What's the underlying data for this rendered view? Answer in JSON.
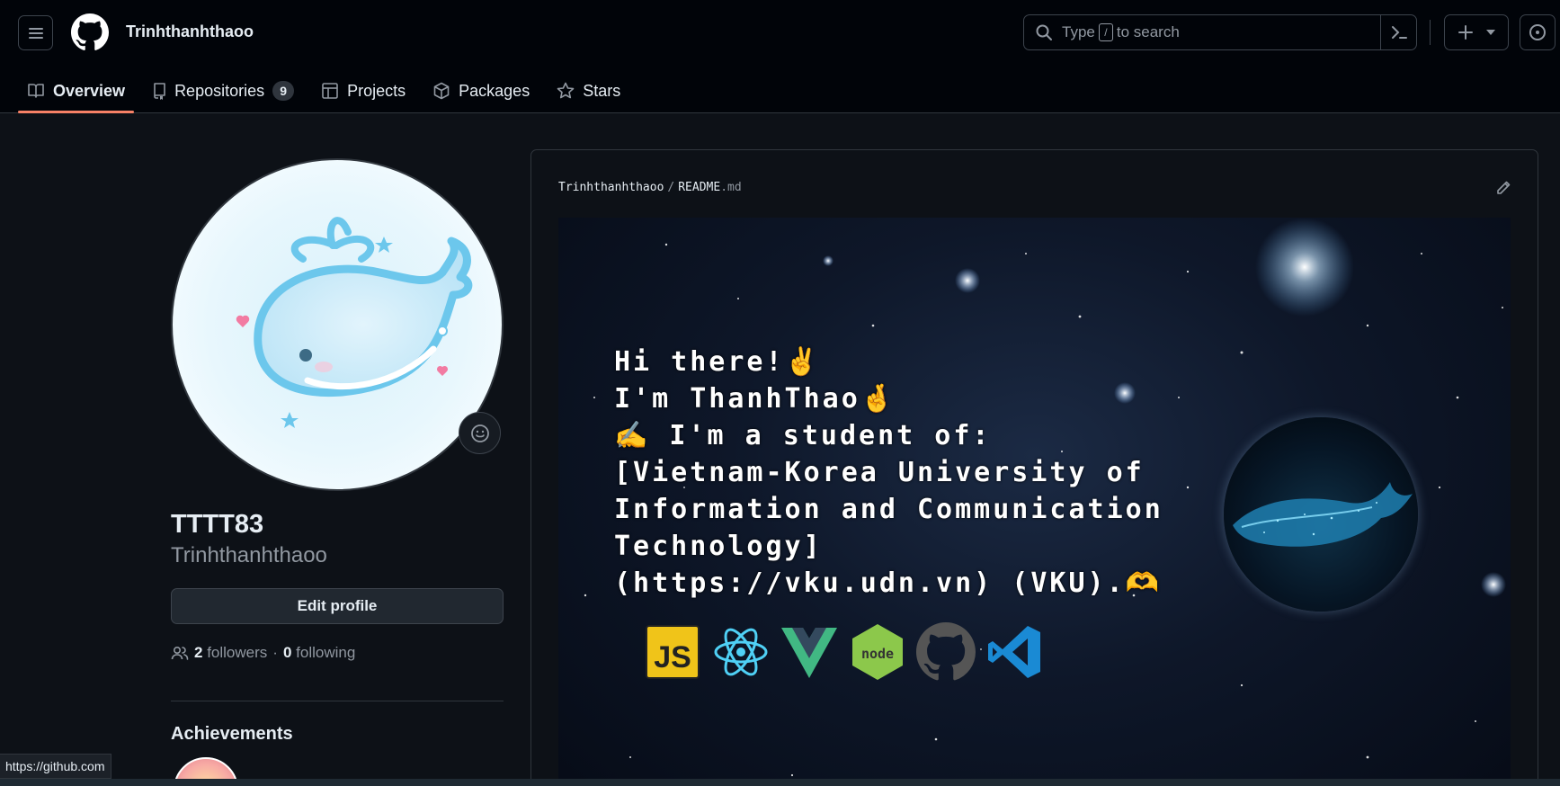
{
  "header": {
    "username": "Trinhthanhthaoo",
    "search": {
      "prefix": "Type",
      "key": "/",
      "suffix": "to search"
    }
  },
  "tabs": [
    {
      "label": "Overview",
      "icon": "book-icon",
      "active": true
    },
    {
      "label": "Repositories",
      "icon": "repo-icon",
      "count": "9"
    },
    {
      "label": "Projects",
      "icon": "table-icon"
    },
    {
      "label": "Packages",
      "icon": "package-icon"
    },
    {
      "label": "Stars",
      "icon": "star-icon"
    }
  ],
  "profile": {
    "display_name": "TTTT83",
    "login": "Trinhthanhthaoo",
    "edit_label": "Edit profile",
    "followers_count": "2",
    "followers_label": "followers",
    "separator": "·",
    "following_count": "0",
    "following_label": "following",
    "achievements_title": "Achievements"
  },
  "readme": {
    "owner": "Trinhthanhthaoo",
    "slash": "/",
    "file": "README",
    "ext": ".md",
    "banner_lines": [
      "Hi there!✌️",
      "I'm ThanhThao🤞",
      "✍️ I'm a student of:",
      "[Vietnam-Korea University of",
      "Information and Communication",
      "Technology]",
      "(https://vku.udn.vn) (VKU).🫶"
    ],
    "tech_icons": [
      "javascript-icon",
      "react-icon",
      "vue-icon",
      "nodejs-icon",
      "github-icon",
      "vscode-icon"
    ]
  },
  "status_bar": {
    "url": "https://github.com"
  },
  "colors": {
    "accent": "#f78166",
    "background": "#0d1117",
    "header": "#010409"
  }
}
